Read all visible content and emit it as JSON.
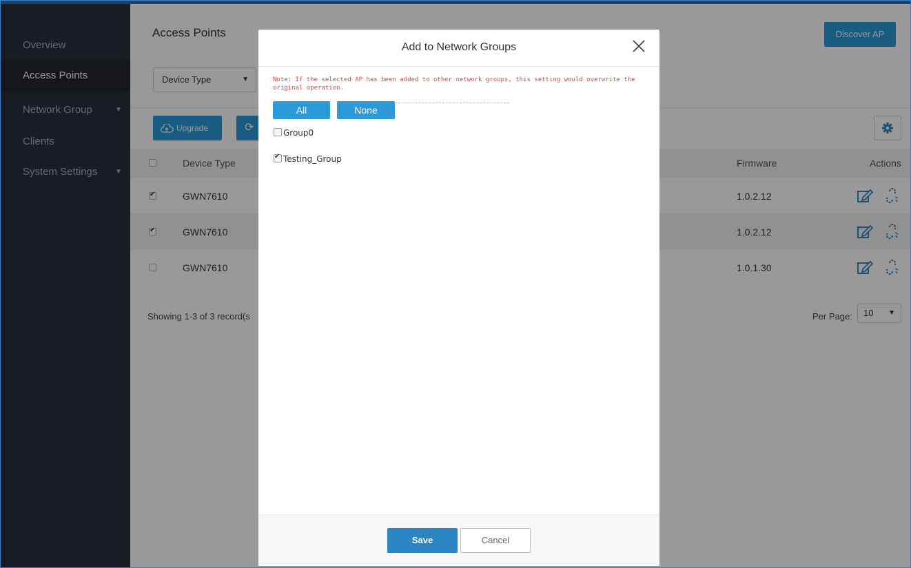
{
  "sidebar": {
    "items": [
      {
        "label": "Overview"
      },
      {
        "label": "Access Points"
      },
      {
        "label": "Network Group"
      },
      {
        "label": "Clients"
      },
      {
        "label": "System Settings"
      }
    ]
  },
  "main": {
    "title": "Access Points",
    "discover_label": "Discover AP",
    "device_type_select": "Device Type",
    "upgrade_label": "Upgrade",
    "table": {
      "headers": {
        "device_type": "Device Type",
        "firmware": "Firmware",
        "actions": "Actions"
      },
      "rows": [
        {
          "checked": true,
          "device_type": "GWN7610",
          "firmware": "1.0.2.12"
        },
        {
          "checked": true,
          "device_type": "GWN7610",
          "firmware": "1.0.2.12"
        },
        {
          "checked": false,
          "device_type": "GWN7610",
          "firmware": "1.0.1.30"
        }
      ]
    },
    "showing_text": "Showing 1-3 of 3 record(s",
    "per_page_label": "Per Page:",
    "per_page_value": "10"
  },
  "modal": {
    "title": "Add to Network Groups",
    "note": "Note: If the selected AP has been added to other network groups, this setting would overwrite the original operation.",
    "all_label": "All",
    "none_label": "None",
    "groups": [
      {
        "name": "Group0",
        "checked": false
      },
      {
        "name": "Testing_Group",
        "checked": true
      }
    ],
    "save_label": "Save",
    "cancel_label": "Cancel"
  },
  "colors": {
    "accent": "#2c9ad8",
    "sidebar_bg": "#2b2f3a",
    "note_red": "#e0443e"
  }
}
